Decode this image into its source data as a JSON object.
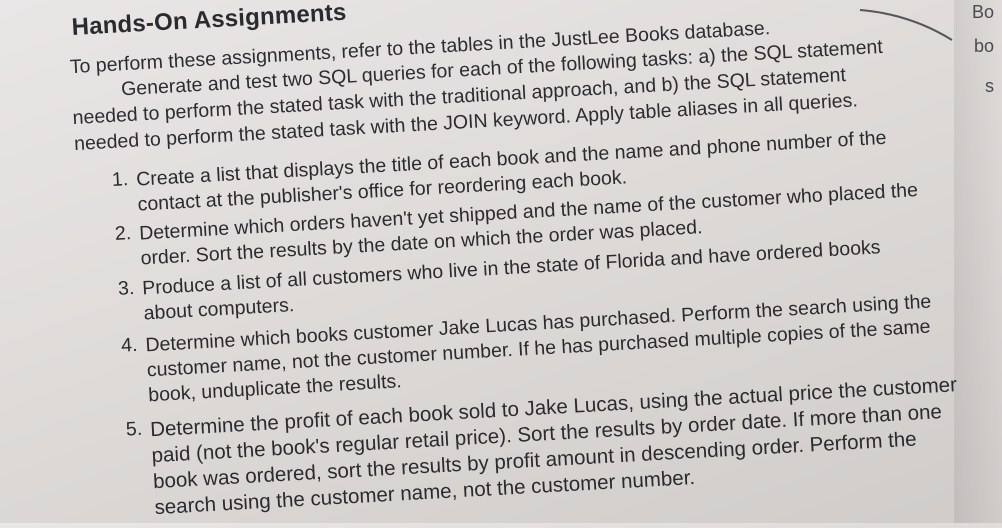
{
  "heading": "Hands-On Assignments",
  "intro": [
    "To perform these assignments, refer to the tables in the JustLee Books database.",
    "Generate and test two SQL queries for each of the following tasks: a) the SQL statement",
    "needed to perform the stated task with the traditional approach, and b) the SQL statement",
    "needed to perform the stated task with the JOIN keyword. Apply table aliases in all queries."
  ],
  "items": [
    {
      "number": "1.",
      "lines": [
        "Create a list that displays the title of each book and the name and phone number of the",
        "contact at the publisher's office for reordering each book."
      ]
    },
    {
      "number": "2.",
      "lines": [
        "Determine which orders haven't yet shipped and the name of the customer who placed the",
        "order. Sort the results by the date on which the order was placed."
      ]
    },
    {
      "number": "3.",
      "lines": [
        "Produce a list of all customers who live in the state of Florida and have ordered books",
        "about computers."
      ]
    },
    {
      "number": "4.",
      "lines": [
        "Determine which books customer Jake Lucas has purchased. Perform the search using the",
        "customer name, not the customer number. If he has purchased multiple copies of the same",
        "book, unduplicate the results."
      ]
    },
    {
      "number": "5.",
      "lines": [
        "Determine the profit of each book sold to Jake Lucas, using the actual price the customer",
        "paid (not the book's regular retail price). Sort the results by order date. If more than one",
        "book was ordered, sort the results by profit amount in descending order. Perform the",
        "search using the customer name, not the customer number."
      ]
    }
  ],
  "edge_fragments": [
    "Bo",
    "bo",
    "s"
  ]
}
